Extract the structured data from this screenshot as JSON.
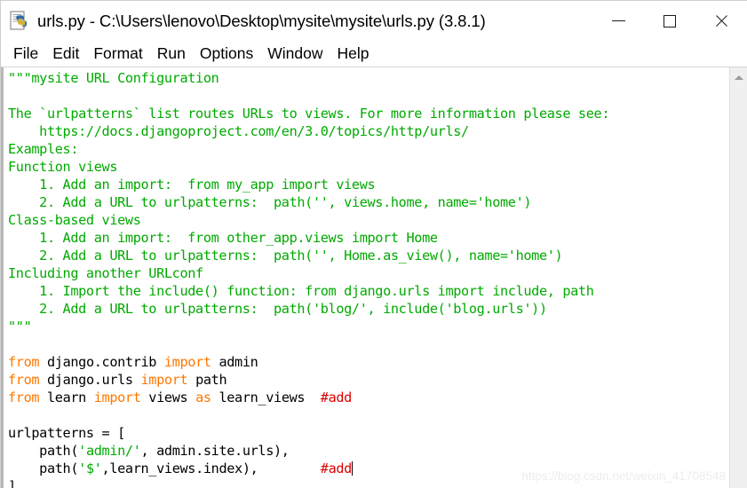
{
  "window": {
    "title": "urls.py - C:\\Users\\lenovo\\Desktop\\mysite\\mysite\\urls.py (3.8.1)",
    "icon": "python-file-icon",
    "controls": {
      "minimize": "minimize-button",
      "maximize": "maximize-button",
      "close": "close-button"
    }
  },
  "menubar": {
    "items": [
      {
        "label": "File"
      },
      {
        "label": "Edit"
      },
      {
        "label": "Format"
      },
      {
        "label": "Run"
      },
      {
        "label": "Options"
      },
      {
        "label": "Window"
      },
      {
        "label": "Help"
      }
    ]
  },
  "colors": {
    "keyword": "#ff7700",
    "string": "#00aa00",
    "docstring": "#00aa00",
    "comment": "#dd0000",
    "plain": "#000000",
    "background": "#ffffff"
  },
  "editor": {
    "language": "python",
    "filename": "urls.py",
    "cursor_line": 24,
    "lines": [
      {
        "n": 1,
        "tokens": [
          {
            "t": "doc",
            "s": "\"\"\"mysite URL Configuration"
          }
        ]
      },
      {
        "n": 2,
        "tokens": [
          {
            "t": "doc",
            "s": ""
          }
        ]
      },
      {
        "n": 3,
        "tokens": [
          {
            "t": "doc",
            "s": "The `urlpatterns` list routes URLs to views. For more information please see:"
          }
        ]
      },
      {
        "n": 4,
        "tokens": [
          {
            "t": "doc",
            "s": "    https://docs.djangoproject.com/en/3.0/topics/http/urls/"
          }
        ]
      },
      {
        "n": 5,
        "tokens": [
          {
            "t": "doc",
            "s": "Examples:"
          }
        ]
      },
      {
        "n": 6,
        "tokens": [
          {
            "t": "doc",
            "s": "Function views"
          }
        ]
      },
      {
        "n": 7,
        "tokens": [
          {
            "t": "doc",
            "s": "    1. Add an import:  from my_app import views"
          }
        ]
      },
      {
        "n": 8,
        "tokens": [
          {
            "t": "doc",
            "s": "    2. Add a URL to urlpatterns:  path('', views.home, name='home')"
          }
        ]
      },
      {
        "n": 9,
        "tokens": [
          {
            "t": "doc",
            "s": "Class-based views"
          }
        ]
      },
      {
        "n": 10,
        "tokens": [
          {
            "t": "doc",
            "s": "    1. Add an import:  from other_app.views import Home"
          }
        ]
      },
      {
        "n": 11,
        "tokens": [
          {
            "t": "doc",
            "s": "    2. Add a URL to urlpatterns:  path('', Home.as_view(), name='home')"
          }
        ]
      },
      {
        "n": 12,
        "tokens": [
          {
            "t": "doc",
            "s": "Including another URLconf"
          }
        ]
      },
      {
        "n": 13,
        "tokens": [
          {
            "t": "doc",
            "s": "    1. Import the include() function: from django.urls import include, path"
          }
        ]
      },
      {
        "n": 14,
        "tokens": [
          {
            "t": "doc",
            "s": "    2. Add a URL to urlpatterns:  path('blog/', include('blog.urls'))"
          }
        ]
      },
      {
        "n": 15,
        "tokens": [
          {
            "t": "doc",
            "s": "\"\"\""
          }
        ]
      },
      {
        "n": 16,
        "tokens": [
          {
            "t": "pln",
            "s": ""
          }
        ]
      },
      {
        "n": 17,
        "tokens": [
          {
            "t": "kw",
            "s": "from"
          },
          {
            "t": "pln",
            "s": " django.contrib "
          },
          {
            "t": "kw",
            "s": "import"
          },
          {
            "t": "pln",
            "s": " admin"
          }
        ]
      },
      {
        "n": 18,
        "tokens": [
          {
            "t": "kw",
            "s": "from"
          },
          {
            "t": "pln",
            "s": " django.urls "
          },
          {
            "t": "kw",
            "s": "import"
          },
          {
            "t": "pln",
            "s": " path"
          }
        ]
      },
      {
        "n": 19,
        "tokens": [
          {
            "t": "kw",
            "s": "from"
          },
          {
            "t": "pln",
            "s": " learn "
          },
          {
            "t": "kw",
            "s": "import"
          },
          {
            "t": "pln",
            "s": " views "
          },
          {
            "t": "kw",
            "s": "as"
          },
          {
            "t": "pln",
            "s": " learn_views  "
          },
          {
            "t": "com",
            "s": "#add"
          }
        ]
      },
      {
        "n": 20,
        "tokens": [
          {
            "t": "pln",
            "s": ""
          }
        ]
      },
      {
        "n": 21,
        "tokens": [
          {
            "t": "pln",
            "s": "urlpatterns = ["
          }
        ]
      },
      {
        "n": 22,
        "tokens": [
          {
            "t": "pln",
            "s": "    path("
          },
          {
            "t": "str",
            "s": "'admin/'"
          },
          {
            "t": "pln",
            "s": ", admin.site.urls),"
          }
        ]
      },
      {
        "n": 23,
        "tokens": [
          {
            "t": "pln",
            "s": "    path("
          },
          {
            "t": "str",
            "s": "'$'"
          },
          {
            "t": "pln",
            "s": ",learn_views.index),        "
          },
          {
            "t": "com",
            "s": "#add"
          },
          {
            "t": "caret",
            "s": ""
          }
        ]
      },
      {
        "n": 24,
        "tokens": [
          {
            "t": "pln",
            "s": "]"
          }
        ]
      }
    ]
  },
  "scrollbar": {
    "up_arrow": "scroll-up-arrow",
    "orientation": "vertical"
  },
  "watermark": {
    "text": "https://blog.csdn.net/weixin_41708548"
  }
}
